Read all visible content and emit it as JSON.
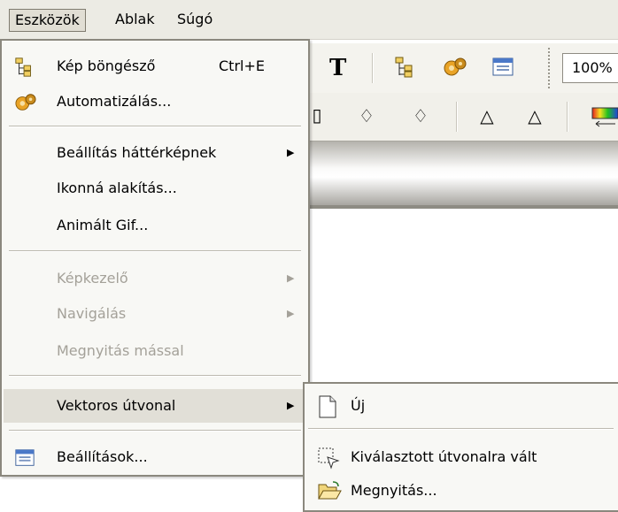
{
  "menubar": {
    "items": [
      "Eszközök",
      "Ablak",
      "Súgó"
    ]
  },
  "toolbar": {
    "zoom_value": "100%"
  },
  "tools_menu": {
    "items": [
      {
        "label": "Kép böngésző",
        "shortcut": "Ctrl+E",
        "icon": "tree-browser-icon"
      },
      {
        "label": "Automatizálás...",
        "icon": "gears-icon"
      },
      {
        "label": "Beállítás háttérképnek",
        "has_submenu": true
      },
      {
        "label": "Ikonná alakítás..."
      },
      {
        "label": "Animált Gif..."
      },
      {
        "label": "Képkezelő",
        "has_submenu": true,
        "disabled": true
      },
      {
        "label": "Navigálás",
        "has_submenu": true,
        "disabled": true
      },
      {
        "label": "Megnyitás mással",
        "disabled": true
      },
      {
        "label": "Vektoros útvonal",
        "has_submenu": true,
        "highlighted": true
      },
      {
        "label": "Beállítások...",
        "icon": "settings-window-icon"
      }
    ]
  },
  "vector_submenu": {
    "items": [
      {
        "label": "Új",
        "icon": "new-document-icon"
      },
      {
        "label": "Kiválasztott útvonalra vált",
        "icon": "selection-path-icon"
      },
      {
        "label": "Megnyitás...",
        "icon": "open-folder-icon"
      }
    ]
  },
  "colors": {
    "highlight": "#e1dfd7",
    "menu_bg": "#f8f8f5",
    "menubar_bg": "#ecebe4",
    "disabled_text": "#a4a199"
  }
}
